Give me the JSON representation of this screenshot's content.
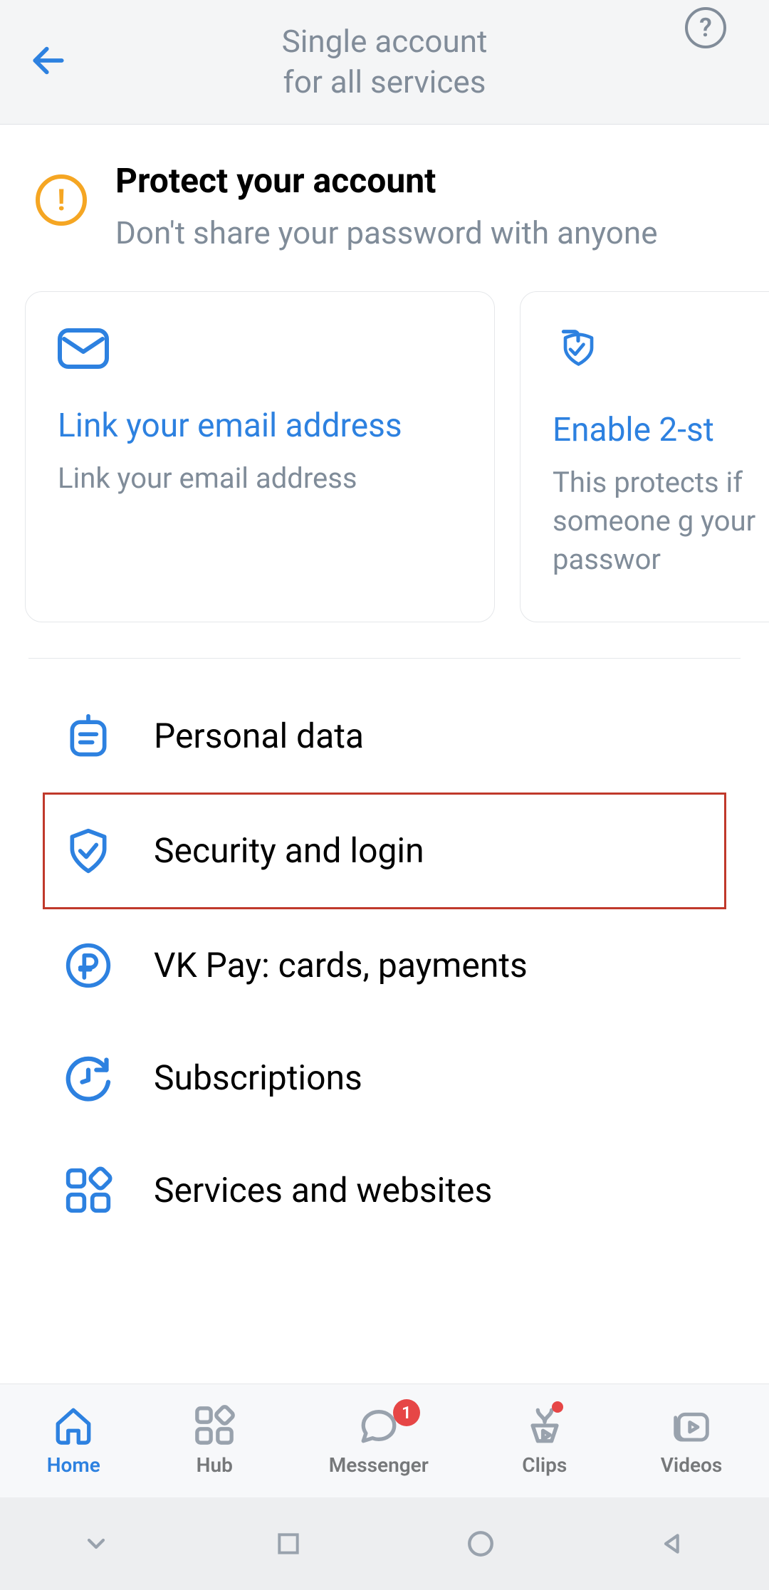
{
  "header": {
    "title_line1": "Single account",
    "title_line2": "for all services"
  },
  "protect": {
    "heading": "Protect your account",
    "subtext": "Don't share your password with anyone"
  },
  "cards": [
    {
      "title": "Link your email address",
      "desc": "Link your email address",
      "icon": "mail-icon"
    },
    {
      "title": "Enable 2-st",
      "desc": "This protects if someone g your passwor",
      "icon": "shield-check-icon"
    }
  ],
  "menu": [
    {
      "label": "Personal data",
      "icon": "personal-data-icon"
    },
    {
      "label": "Security and login",
      "icon": "shield-check-icon",
      "highlighted": true
    },
    {
      "label": "VK Pay: cards, payments",
      "icon": "ruble-circle-icon"
    },
    {
      "label": "Subscriptions",
      "icon": "clock-rotate-icon"
    },
    {
      "label": "Services and websites",
      "icon": "grid-icon"
    }
  ],
  "nav": {
    "home": "Home",
    "hub": "Hub",
    "messenger": "Messenger",
    "clips": "Clips",
    "videos": "Videos",
    "messenger_badge": "1"
  },
  "colors": {
    "accent": "#2d81e0",
    "warning": "#f5a623",
    "danger": "#e64646",
    "highlight_border": "#c0392b",
    "muted": "#808c99"
  }
}
